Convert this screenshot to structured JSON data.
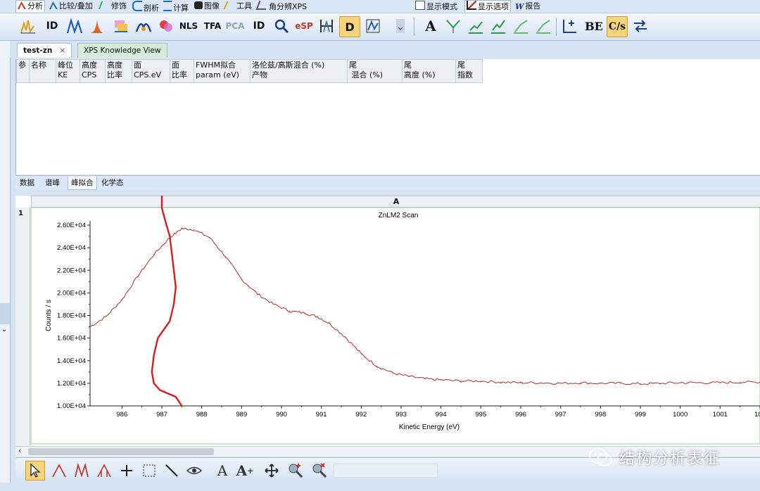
{
  "menubar": {
    "items": [
      {
        "label": "分析",
        "active": true
      },
      {
        "label": "比较/叠加"
      },
      {
        "label": "修饰"
      },
      {
        "label": "剖析"
      },
      {
        "label": "计算"
      },
      {
        "label": "图像"
      },
      {
        "label": "工具"
      },
      {
        "label": "角分辨XPS"
      },
      {
        "label": "显示模式"
      },
      {
        "label": "显示选项",
        "active": true
      },
      {
        "label": "报告"
      }
    ]
  },
  "toolbar": {
    "buttons": [
      {
        "icon": "peak-spectrum-icon"
      },
      {
        "text": "ID"
      },
      {
        "icon": "peak-fit-icon"
      },
      {
        "icon": "peak-height-icon"
      },
      {
        "icon": "chart-compare-icon"
      },
      {
        "icon": "peak-label-icon"
      },
      {
        "icon": "color-map-icon"
      },
      {
        "text": "NLS"
      },
      {
        "text": "TFA"
      },
      {
        "text": "PCA"
      },
      {
        "text": "ID"
      },
      {
        "icon": "magnifier-spectrum-icon"
      },
      {
        "text": "eSP"
      },
      {
        "icon": "range-marker-icon"
      },
      {
        "text": "D",
        "pressed": true
      },
      {
        "icon": "phi-scan-icon"
      },
      {
        "icon": "dropdown-arrow-icon"
      },
      {
        "text": "A"
      },
      {
        "icon": "scissors-peak-icon"
      },
      {
        "icon": "chart-bar-up-icon"
      },
      {
        "icon": "chart-bar-up2-icon"
      },
      {
        "icon": "trend-check-icon"
      },
      {
        "icon": "trend-check2-icon"
      },
      {
        "icon": "chart-add-icon"
      },
      {
        "text": "BE"
      },
      {
        "text": "C/s",
        "pressed": true
      },
      {
        "icon": "swap-axis-icon"
      }
    ]
  },
  "tabs": [
    {
      "label": "test-zn",
      "active": true,
      "close": "×"
    },
    {
      "label": "XPS Knowledge View"
    }
  ],
  "peak_table": {
    "headers": [
      "参",
      "名称",
      "峰位\nKE",
      "高度\nCPS",
      "高度\n比率",
      "面\nCPS.eV",
      "面\n比率",
      "FWHM拟合\nparam (eV)",
      "洛伦兹/高斯混合 (%)\n产物",
      "尾\n 混合 (%)",
      "尾\n高度 (%)",
      "尾\n指数"
    ]
  },
  "subtabs": [
    "数据",
    "谱峰",
    "峰拟合",
    "化学态"
  ],
  "plot": {
    "column_label": "A",
    "row_label": "1"
  },
  "chart_data": {
    "type": "line",
    "title": "ZnLM2 Scan",
    "xlabel": "Kinetic Energy (eV)",
    "ylabel": "Counts / s",
    "xlim": [
      985.2,
      1002
    ],
    "ylim": [
      10000,
      26000
    ],
    "xticks": [
      "986",
      "987",
      "988",
      "989",
      "990",
      "991",
      "992",
      "993",
      "994",
      "995",
      "996",
      "997",
      "998",
      "999",
      "1000",
      "1001",
      "100"
    ],
    "yticks": [
      "1.00E+04",
      "1.20E+04",
      "1.40E+04",
      "1.60E+04",
      "1.80E+04",
      "2.00E+04",
      "2.20E+04",
      "2.40E+04",
      "2.60E+04"
    ],
    "line_color": "#b22b2b",
    "series": [
      {
        "x": [
          985.2,
          985.6,
          986.0,
          986.4,
          986.8,
          987.2,
          987.5,
          987.8,
          988.2,
          988.6,
          989.0,
          989.4,
          989.8,
          990.2,
          990.6,
          990.9,
          991.2,
          991.6,
          992.0,
          992.4,
          992.8,
          993.2,
          993.6,
          994.0,
          994.5,
          995.0,
          995.5,
          996.0,
          996.5,
          997.0,
          997.5,
          998.0,
          998.5,
          999.0,
          999.5,
          1000.0,
          1000.5,
          1001.0,
          1001.5,
          1002.0
        ],
        "y": [
          17000,
          17900,
          19400,
          21500,
          23400,
          24900,
          25700,
          25600,
          24900,
          23200,
          21200,
          19900,
          19000,
          18400,
          18200,
          17900,
          17300,
          16100,
          14600,
          13500,
          12900,
          12600,
          12400,
          12300,
          12200,
          12200,
          12100,
          12050,
          12050,
          12000,
          12050,
          12000,
          12000,
          11950,
          12000,
          12050,
          12050,
          12050,
          12100,
          12100
        ]
      }
    ],
    "grid": false
  },
  "annotation": {
    "hand_drawn_marker_color": "#d11f1f",
    "marker_x": [
      987.1,
      987.0,
      987.0,
      987.1,
      987.2,
      987.25,
      987.3,
      987.35,
      987.3,
      987.2,
      986.9,
      986.8,
      986.75,
      986.8,
      986.95,
      987.35,
      987.5
    ],
    "marker_y": [
      30300,
      29000,
      27500,
      26200,
      25000,
      23500,
      22000,
      20500,
      19000,
      17500,
      16000,
      14500,
      13000,
      12000,
      11400,
      10800,
      10000
    ]
  },
  "bottom_toolbar": {
    "buttons": [
      {
        "icon": "select-arrow-icon",
        "pressed": true
      },
      {
        "icon": "peak-add-icon"
      },
      {
        "icon": "peak-region-icon"
      },
      {
        "icon": "peak-multi-icon"
      },
      {
        "icon": "crosshair-plus-icon"
      },
      {
        "icon": "marquee-select-icon"
      },
      {
        "icon": "line-draw-icon"
      },
      {
        "icon": "eye-icon"
      },
      {
        "icon": "text-tool-icon"
      },
      {
        "icon": "text-enlarge-icon"
      },
      {
        "icon": "move-pan-icon"
      },
      {
        "icon": "zoom-in-icon"
      },
      {
        "icon": "zoom-reset-icon"
      }
    ]
  },
  "watermark": "结构分析表征"
}
